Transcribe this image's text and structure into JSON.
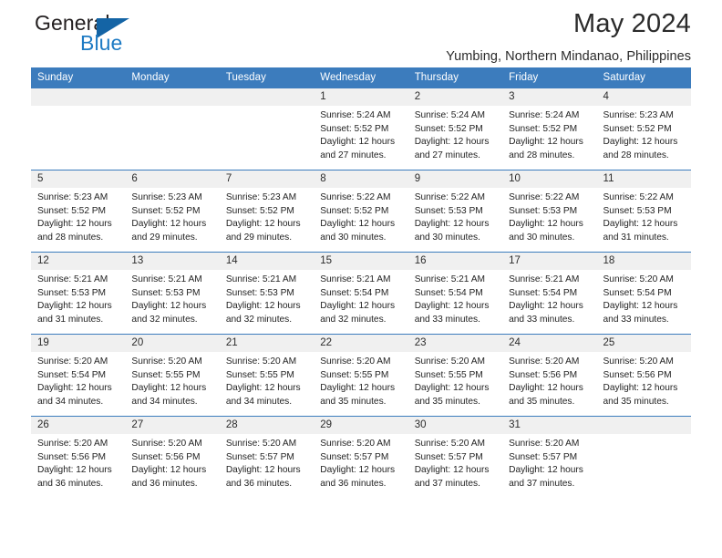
{
  "brand": {
    "word1": "General",
    "word2": "Blue",
    "flag_icon": "triangle-flag-icon",
    "colors": {
      "general": "#231f20",
      "blue": "#1e7bc4",
      "flag": "#1464a5"
    }
  },
  "header": {
    "title": "May 2024",
    "subtitle": "Yumbing, Northern Mindanao, Philippines"
  },
  "theme": {
    "header_bg": "#3c7cbd",
    "header_text": "#ffffff",
    "daynum_bg": "#f0f0f0",
    "row_border": "#3c7cbd",
    "body_text": "#232323"
  },
  "calendar": {
    "weekday_headers": [
      "Sunday",
      "Monday",
      "Tuesday",
      "Wednesday",
      "Thursday",
      "Friday",
      "Saturday"
    ],
    "weeks": [
      [
        {
          "day": "",
          "lines": []
        },
        {
          "day": "",
          "lines": []
        },
        {
          "day": "",
          "lines": []
        },
        {
          "day": "1",
          "lines": [
            "Sunrise: 5:24 AM",
            "Sunset: 5:52 PM",
            "Daylight: 12 hours",
            "and 27 minutes."
          ]
        },
        {
          "day": "2",
          "lines": [
            "Sunrise: 5:24 AM",
            "Sunset: 5:52 PM",
            "Daylight: 12 hours",
            "and 27 minutes."
          ]
        },
        {
          "day": "3",
          "lines": [
            "Sunrise: 5:24 AM",
            "Sunset: 5:52 PM",
            "Daylight: 12 hours",
            "and 28 minutes."
          ]
        },
        {
          "day": "4",
          "lines": [
            "Sunrise: 5:23 AM",
            "Sunset: 5:52 PM",
            "Daylight: 12 hours",
            "and 28 minutes."
          ]
        }
      ],
      [
        {
          "day": "5",
          "lines": [
            "Sunrise: 5:23 AM",
            "Sunset: 5:52 PM",
            "Daylight: 12 hours",
            "and 28 minutes."
          ]
        },
        {
          "day": "6",
          "lines": [
            "Sunrise: 5:23 AM",
            "Sunset: 5:52 PM",
            "Daylight: 12 hours",
            "and 29 minutes."
          ]
        },
        {
          "day": "7",
          "lines": [
            "Sunrise: 5:23 AM",
            "Sunset: 5:52 PM",
            "Daylight: 12 hours",
            "and 29 minutes."
          ]
        },
        {
          "day": "8",
          "lines": [
            "Sunrise: 5:22 AM",
            "Sunset: 5:52 PM",
            "Daylight: 12 hours",
            "and 30 minutes."
          ]
        },
        {
          "day": "9",
          "lines": [
            "Sunrise: 5:22 AM",
            "Sunset: 5:53 PM",
            "Daylight: 12 hours",
            "and 30 minutes."
          ]
        },
        {
          "day": "10",
          "lines": [
            "Sunrise: 5:22 AM",
            "Sunset: 5:53 PM",
            "Daylight: 12 hours",
            "and 30 minutes."
          ]
        },
        {
          "day": "11",
          "lines": [
            "Sunrise: 5:22 AM",
            "Sunset: 5:53 PM",
            "Daylight: 12 hours",
            "and 31 minutes."
          ]
        }
      ],
      [
        {
          "day": "12",
          "lines": [
            "Sunrise: 5:21 AM",
            "Sunset: 5:53 PM",
            "Daylight: 12 hours",
            "and 31 minutes."
          ]
        },
        {
          "day": "13",
          "lines": [
            "Sunrise: 5:21 AM",
            "Sunset: 5:53 PM",
            "Daylight: 12 hours",
            "and 32 minutes."
          ]
        },
        {
          "day": "14",
          "lines": [
            "Sunrise: 5:21 AM",
            "Sunset: 5:53 PM",
            "Daylight: 12 hours",
            "and 32 minutes."
          ]
        },
        {
          "day": "15",
          "lines": [
            "Sunrise: 5:21 AM",
            "Sunset: 5:54 PM",
            "Daylight: 12 hours",
            "and 32 minutes."
          ]
        },
        {
          "day": "16",
          "lines": [
            "Sunrise: 5:21 AM",
            "Sunset: 5:54 PM",
            "Daylight: 12 hours",
            "and 33 minutes."
          ]
        },
        {
          "day": "17",
          "lines": [
            "Sunrise: 5:21 AM",
            "Sunset: 5:54 PM",
            "Daylight: 12 hours",
            "and 33 minutes."
          ]
        },
        {
          "day": "18",
          "lines": [
            "Sunrise: 5:20 AM",
            "Sunset: 5:54 PM",
            "Daylight: 12 hours",
            "and 33 minutes."
          ]
        }
      ],
      [
        {
          "day": "19",
          "lines": [
            "Sunrise: 5:20 AM",
            "Sunset: 5:54 PM",
            "Daylight: 12 hours",
            "and 34 minutes."
          ]
        },
        {
          "day": "20",
          "lines": [
            "Sunrise: 5:20 AM",
            "Sunset: 5:55 PM",
            "Daylight: 12 hours",
            "and 34 minutes."
          ]
        },
        {
          "day": "21",
          "lines": [
            "Sunrise: 5:20 AM",
            "Sunset: 5:55 PM",
            "Daylight: 12 hours",
            "and 34 minutes."
          ]
        },
        {
          "day": "22",
          "lines": [
            "Sunrise: 5:20 AM",
            "Sunset: 5:55 PM",
            "Daylight: 12 hours",
            "and 35 minutes."
          ]
        },
        {
          "day": "23",
          "lines": [
            "Sunrise: 5:20 AM",
            "Sunset: 5:55 PM",
            "Daylight: 12 hours",
            "and 35 minutes."
          ]
        },
        {
          "day": "24",
          "lines": [
            "Sunrise: 5:20 AM",
            "Sunset: 5:56 PM",
            "Daylight: 12 hours",
            "and 35 minutes."
          ]
        },
        {
          "day": "25",
          "lines": [
            "Sunrise: 5:20 AM",
            "Sunset: 5:56 PM",
            "Daylight: 12 hours",
            "and 35 minutes."
          ]
        }
      ],
      [
        {
          "day": "26",
          "lines": [
            "Sunrise: 5:20 AM",
            "Sunset: 5:56 PM",
            "Daylight: 12 hours",
            "and 36 minutes."
          ]
        },
        {
          "day": "27",
          "lines": [
            "Sunrise: 5:20 AM",
            "Sunset: 5:56 PM",
            "Daylight: 12 hours",
            "and 36 minutes."
          ]
        },
        {
          "day": "28",
          "lines": [
            "Sunrise: 5:20 AM",
            "Sunset: 5:57 PM",
            "Daylight: 12 hours",
            "and 36 minutes."
          ]
        },
        {
          "day": "29",
          "lines": [
            "Sunrise: 5:20 AM",
            "Sunset: 5:57 PM",
            "Daylight: 12 hours",
            "and 36 minutes."
          ]
        },
        {
          "day": "30",
          "lines": [
            "Sunrise: 5:20 AM",
            "Sunset: 5:57 PM",
            "Daylight: 12 hours",
            "and 37 minutes."
          ]
        },
        {
          "day": "31",
          "lines": [
            "Sunrise: 5:20 AM",
            "Sunset: 5:57 PM",
            "Daylight: 12 hours",
            "and 37 minutes."
          ]
        },
        {
          "day": "",
          "lines": []
        }
      ]
    ]
  }
}
